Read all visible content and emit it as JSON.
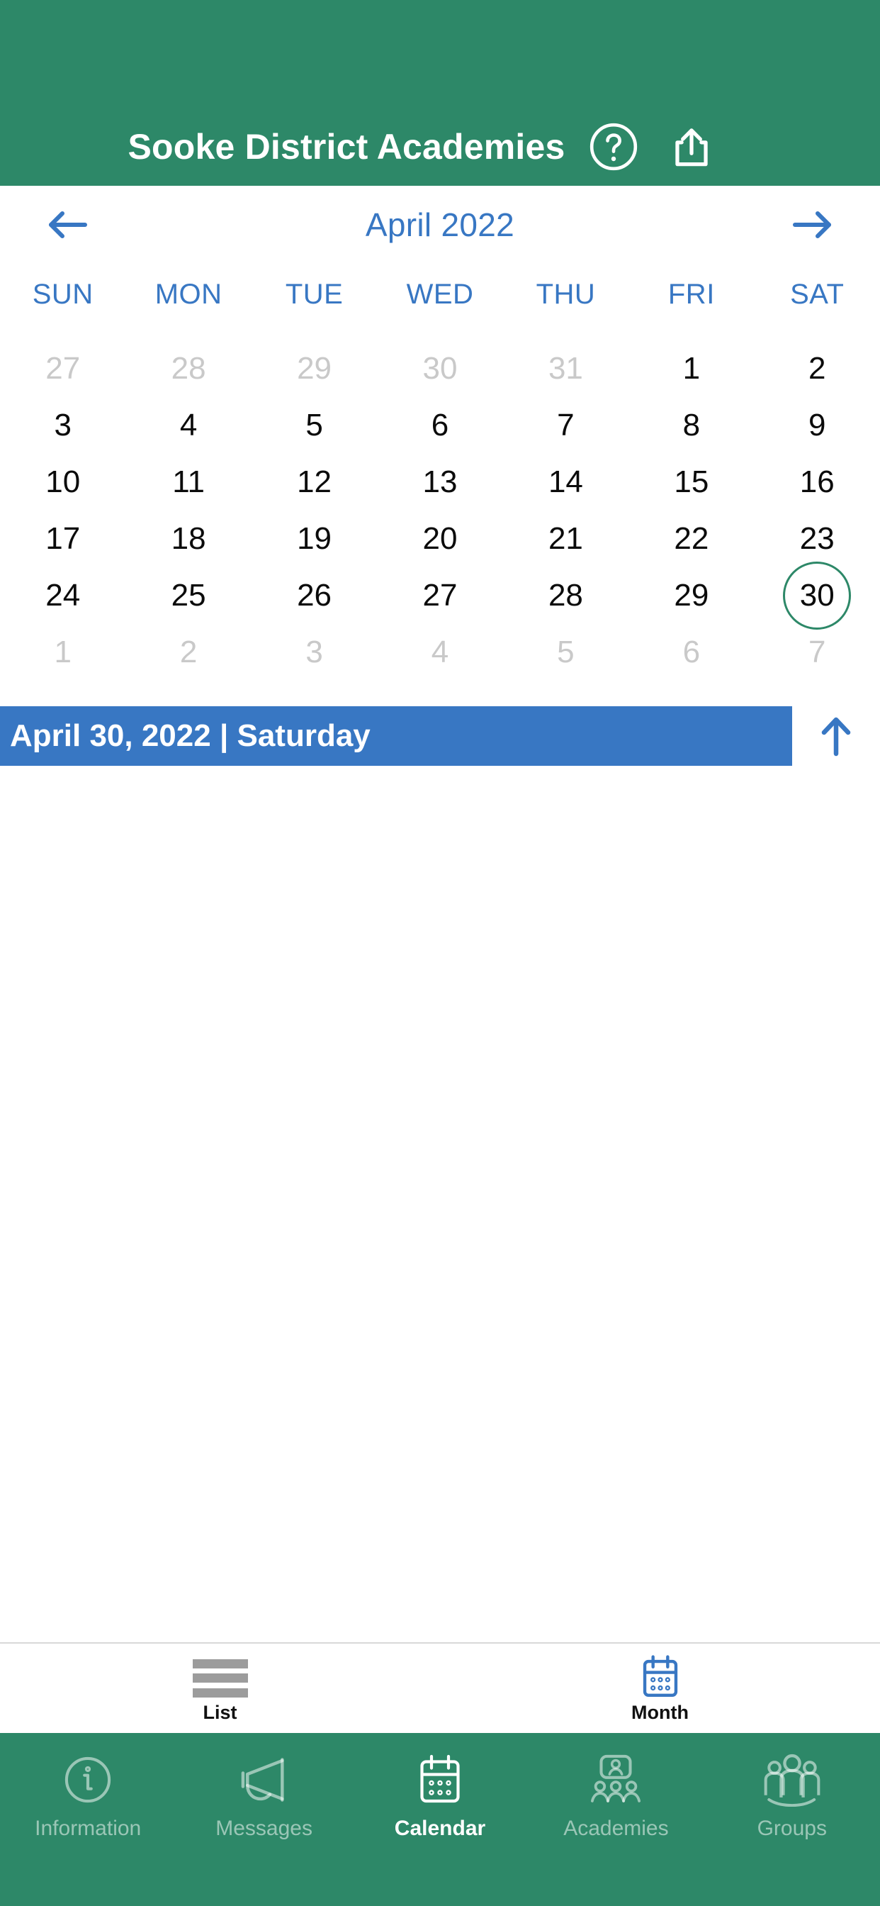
{
  "header": {
    "title": "Sooke District Academies",
    "background_color": "#2d8868",
    "help_icon": "question-mark-circle-icon",
    "share_icon": "share-icon"
  },
  "calendar": {
    "month_label": "April 2022",
    "prev_icon": "arrow-left-icon",
    "next_icon": "arrow-right-icon",
    "accent_color": "#3877c3",
    "selected_ring_color": "#2d8868",
    "weekdays": [
      "SUN",
      "MON",
      "TUE",
      "WED",
      "THU",
      "FRI",
      "SAT"
    ],
    "weeks": [
      [
        {
          "label": "27",
          "muted": true,
          "selected": false
        },
        {
          "label": "28",
          "muted": true,
          "selected": false
        },
        {
          "label": "29",
          "muted": true,
          "selected": false
        },
        {
          "label": "30",
          "muted": true,
          "selected": false
        },
        {
          "label": "31",
          "muted": true,
          "selected": false
        },
        {
          "label": "1",
          "muted": false,
          "selected": false
        },
        {
          "label": "2",
          "muted": false,
          "selected": false
        }
      ],
      [
        {
          "label": "3",
          "muted": false,
          "selected": false
        },
        {
          "label": "4",
          "muted": false,
          "selected": false
        },
        {
          "label": "5",
          "muted": false,
          "selected": false
        },
        {
          "label": "6",
          "muted": false,
          "selected": false
        },
        {
          "label": "7",
          "muted": false,
          "selected": false
        },
        {
          "label": "8",
          "muted": false,
          "selected": false
        },
        {
          "label": "9",
          "muted": false,
          "selected": false
        }
      ],
      [
        {
          "label": "10",
          "muted": false,
          "selected": false
        },
        {
          "label": "11",
          "muted": false,
          "selected": false
        },
        {
          "label": "12",
          "muted": false,
          "selected": false
        },
        {
          "label": "13",
          "muted": false,
          "selected": false
        },
        {
          "label": "14",
          "muted": false,
          "selected": false
        },
        {
          "label": "15",
          "muted": false,
          "selected": false
        },
        {
          "label": "16",
          "muted": false,
          "selected": false
        }
      ],
      [
        {
          "label": "17",
          "muted": false,
          "selected": false
        },
        {
          "label": "18",
          "muted": false,
          "selected": false
        },
        {
          "label": "19",
          "muted": false,
          "selected": false
        },
        {
          "label": "20",
          "muted": false,
          "selected": false
        },
        {
          "label": "21",
          "muted": false,
          "selected": false
        },
        {
          "label": "22",
          "muted": false,
          "selected": false
        },
        {
          "label": "23",
          "muted": false,
          "selected": false
        }
      ],
      [
        {
          "label": "24",
          "muted": false,
          "selected": false
        },
        {
          "label": "25",
          "muted": false,
          "selected": false
        },
        {
          "label": "26",
          "muted": false,
          "selected": false
        },
        {
          "label": "27",
          "muted": false,
          "selected": false
        },
        {
          "label": "28",
          "muted": false,
          "selected": false
        },
        {
          "label": "29",
          "muted": false,
          "selected": false
        },
        {
          "label": "30",
          "muted": false,
          "selected": true
        }
      ],
      [
        {
          "label": "1",
          "muted": true,
          "selected": false
        },
        {
          "label": "2",
          "muted": true,
          "selected": false
        },
        {
          "label": "3",
          "muted": true,
          "selected": false
        },
        {
          "label": "4",
          "muted": true,
          "selected": false
        },
        {
          "label": "5",
          "muted": true,
          "selected": false
        },
        {
          "label": "6",
          "muted": true,
          "selected": false
        },
        {
          "label": "7",
          "muted": true,
          "selected": false
        }
      ]
    ]
  },
  "date_banner": {
    "text": "April 30, 2022 | Saturday",
    "background_color": "#3877c3",
    "scroll_icon": "arrow-up-icon"
  },
  "view_switch": {
    "tabs": [
      {
        "label": "List",
        "icon": "list-icon",
        "active": false
      },
      {
        "label": "Month",
        "icon": "calendar-icon",
        "active": true
      }
    ]
  },
  "bottom_nav": {
    "background_color": "#2d8868",
    "items": [
      {
        "label": "Information",
        "icon": "info-circle-icon",
        "active": false
      },
      {
        "label": "Messages",
        "icon": "megaphone-icon",
        "active": false
      },
      {
        "label": "Calendar",
        "icon": "calendar-icon",
        "active": true
      },
      {
        "label": "Academies",
        "icon": "academies-icon",
        "active": false
      },
      {
        "label": "Groups",
        "icon": "groups-icon",
        "active": false
      }
    ]
  }
}
